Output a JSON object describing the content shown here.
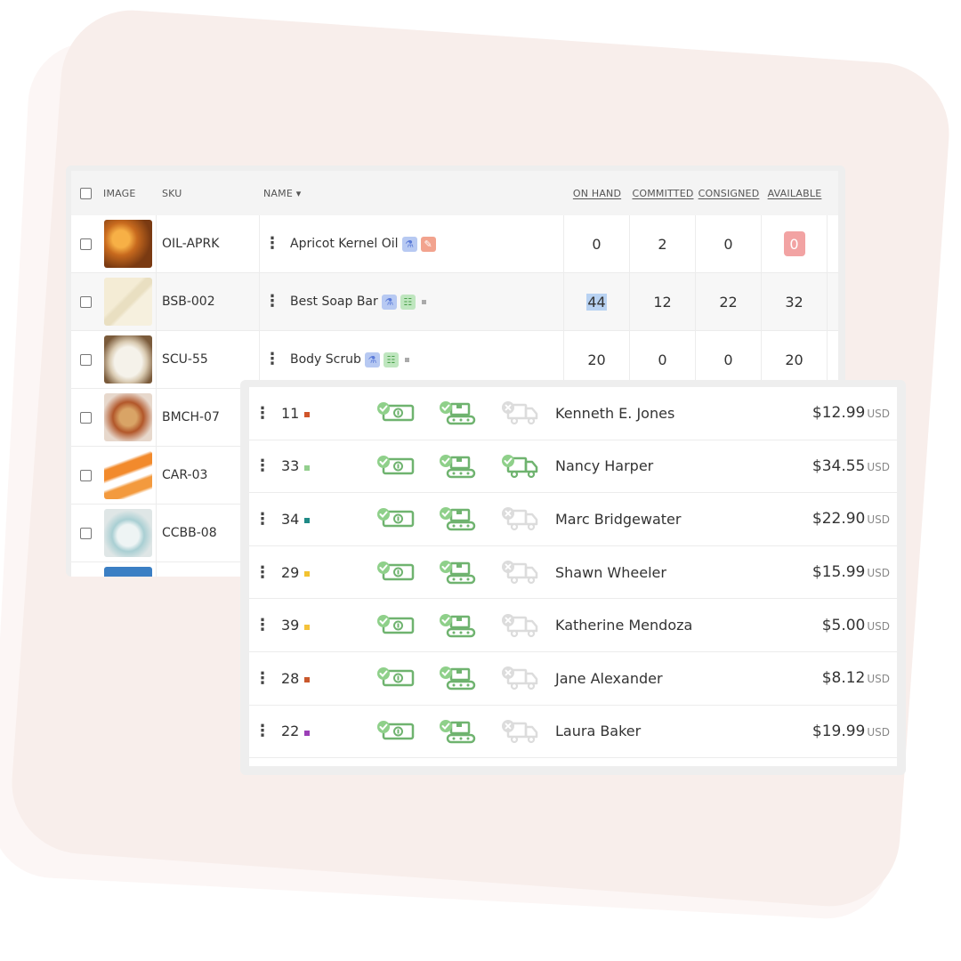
{
  "inventory": {
    "columns": {
      "image": "IMAGE",
      "sku": "SKU",
      "name": "NAME ▾",
      "on_hand": "ON HAND",
      "committed": "COMMITTED",
      "consigned": "CONSIGNED",
      "available": "AVAILABLE"
    },
    "rows": [
      {
        "sku": "OIL-APRK",
        "name": "Apricot Kernel Oil",
        "on_hand": "0",
        "committed": "2",
        "consigned": "0",
        "available": "0"
      },
      {
        "sku": "BSB-002",
        "name": "Best Soap Bar",
        "on_hand": "44",
        "committed": "12",
        "consigned": "22",
        "available": "32"
      },
      {
        "sku": "SCU-55",
        "name": "Body Scrub",
        "on_hand": "20",
        "committed": "0",
        "consigned": "0",
        "available": "20"
      },
      {
        "sku": "BMCH-07"
      },
      {
        "sku": "CAR-03"
      },
      {
        "sku": "CCBB-08"
      },
      {
        "sku": ""
      }
    ]
  },
  "orders": {
    "currency": "USD",
    "rows": [
      {
        "qty": "11",
        "color": "#d0552a",
        "customer": "Kenneth E. Jones",
        "price": "$12.99",
        "shipped": false
      },
      {
        "qty": "33",
        "color": "#93cf8e",
        "customer": "Nancy Harper",
        "price": "$34.55",
        "shipped": true
      },
      {
        "qty": "34",
        "color": "#1f8a86",
        "customer": "Marc Bridgewater",
        "price": "$22.90",
        "shipped": false
      },
      {
        "qty": "29",
        "color": "#f2c230",
        "customer": "Shawn Wheeler",
        "price": "$15.99",
        "shipped": false
      },
      {
        "qty": "39",
        "color": "#f4c23a",
        "customer": "Katherine Mendoza",
        "price": "$5.00",
        "shipped": false
      },
      {
        "qty": "28",
        "color": "#c9582c",
        "customer": "Jane Alexander",
        "price": "$8.12",
        "shipped": false
      },
      {
        "qty": "22",
        "color": "#9b3fb7",
        "customer": "Laura Baker",
        "price": "$19.99",
        "shipped": false
      }
    ]
  },
  "icons": {
    "paid": "money-check-icon",
    "manufactured": "conveyor-check-icon",
    "shipped": "truck-check-icon",
    "not_shipped": "truck-x-icon"
  },
  "colors": {
    "success_green": "#6fb36f",
    "check_green": "#8fd08a",
    "disabled_gray": "#dcdcdc",
    "available_zero_badge": "#f2a3a3",
    "highlight": "#b8d2f2"
  }
}
